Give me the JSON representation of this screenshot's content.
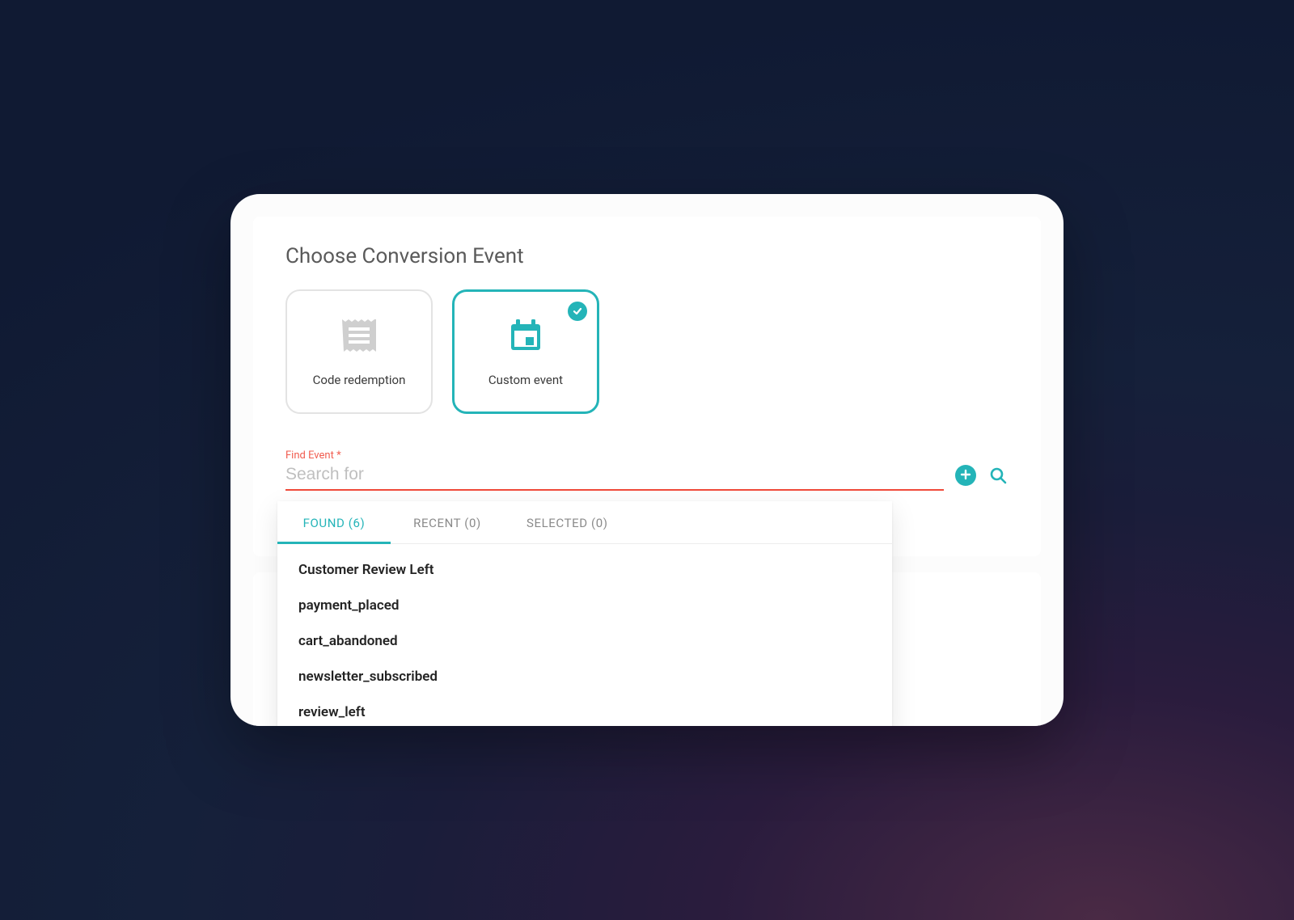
{
  "title": "Choose Conversion Event",
  "options": {
    "code_redemption": {
      "label": "Code redemption",
      "icon": "receipt-icon",
      "selected": false
    },
    "custom_event": {
      "label": "Custom event",
      "icon": "calendar-icon",
      "selected": true
    }
  },
  "field": {
    "label": "Find Event *",
    "placeholder": "Search for",
    "value": "",
    "accent": "#f04a3a"
  },
  "actions": {
    "add": "add-icon",
    "search": "search-icon"
  },
  "dropdown": {
    "tabs": {
      "found": {
        "label": "FOUND (6)",
        "active": true
      },
      "recent": {
        "label": "RECENT (0)",
        "active": false
      },
      "selected": {
        "label": "SELECTED (0)",
        "active": false
      }
    },
    "results": [
      "Customer Review Left",
      "payment_placed",
      "cart_abandoned",
      "newsletter_subscribed",
      "review_left"
    ]
  },
  "colors": {
    "brand": "#24b4b8",
    "error": "#f04a3a",
    "text_muted": "#8a8a8a"
  }
}
